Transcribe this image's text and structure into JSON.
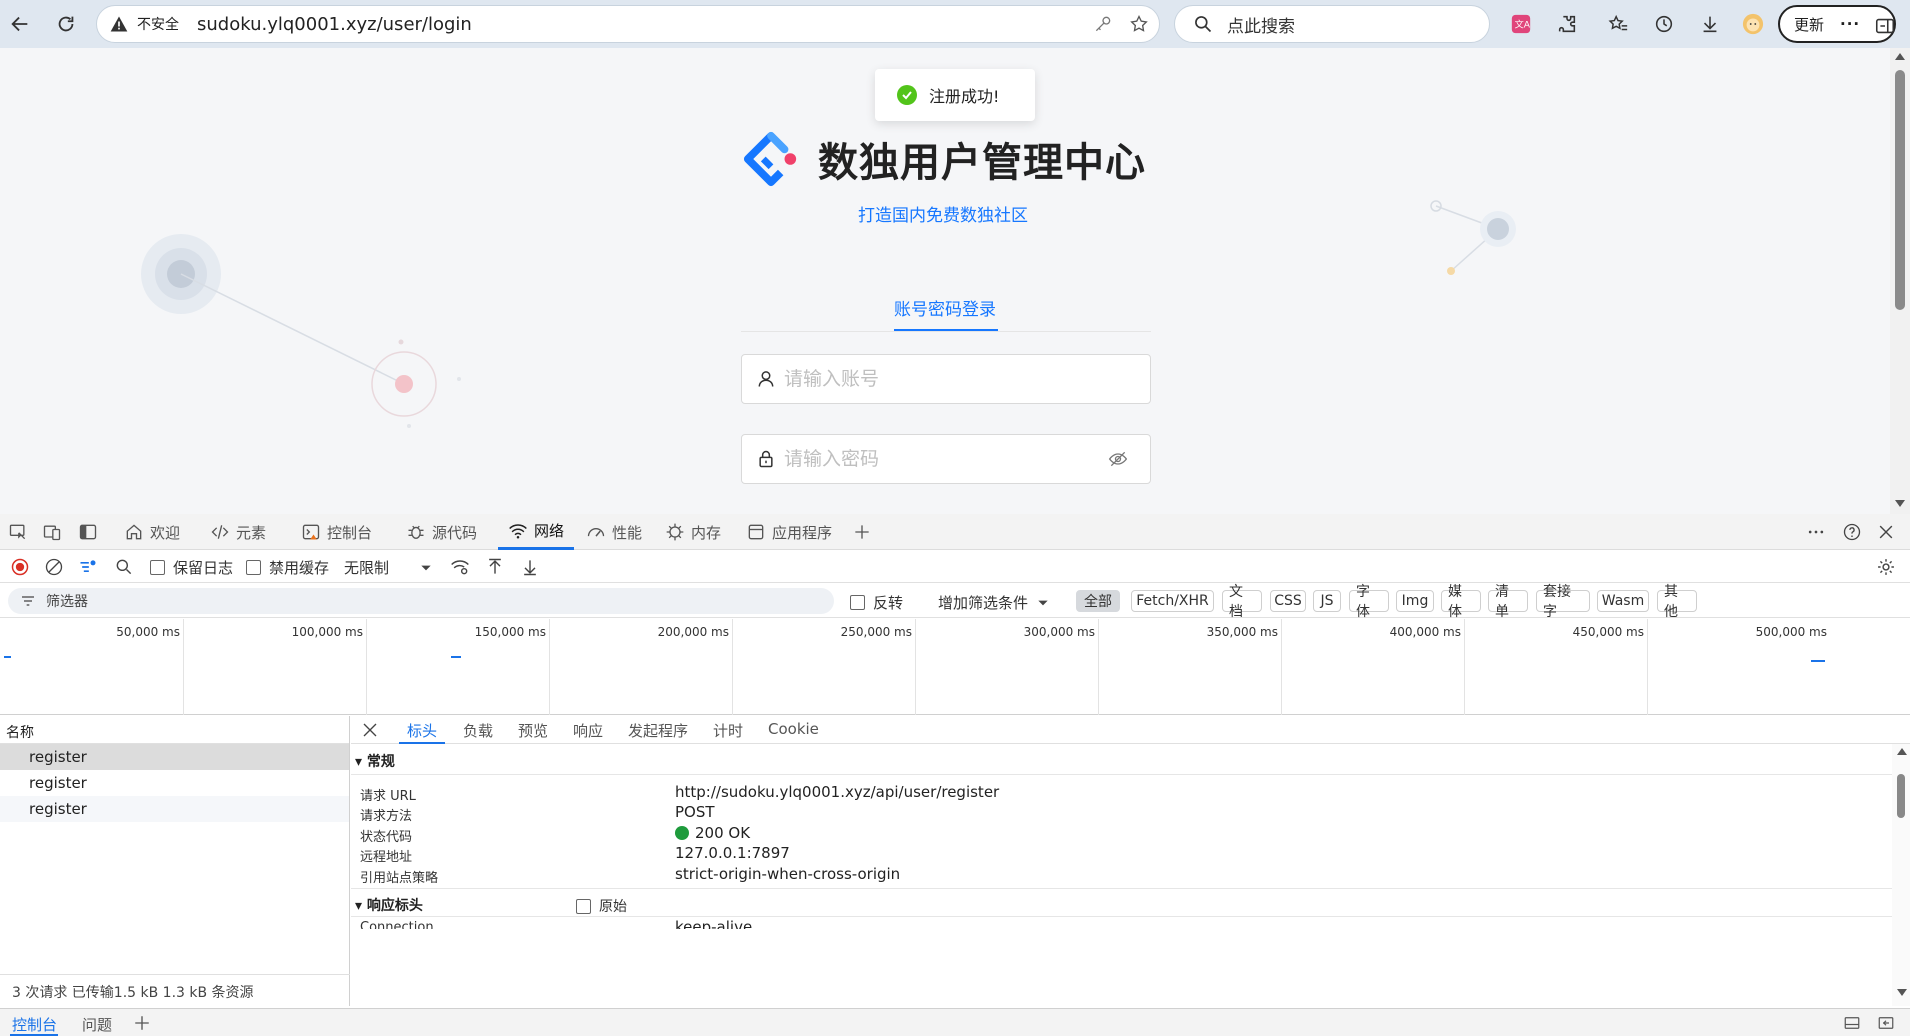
{
  "browser": {
    "insecure_label": "不安全",
    "url": "sudoku.ylq0001.xyz/user/login",
    "search_placeholder": "点此搜索",
    "update_label": "更新",
    "more_label": "···"
  },
  "page": {
    "toast": "注册成功!",
    "title": "数独用户管理中心",
    "tagline": "打造国内免费数独社区",
    "login_tab": "账号密码登录",
    "account_placeholder": "请输入账号",
    "password_placeholder": "请输入密码"
  },
  "devtools": {
    "tabs": [
      "欢迎",
      "元素",
      "控制台",
      "源代码",
      "网络",
      "性能",
      "内存",
      "应用程序"
    ],
    "active_tab": "网络",
    "toolbar": {
      "preserve_log": "保留日志",
      "disable_cache": "禁用缓存",
      "throttling": "无限制"
    },
    "filter": {
      "placeholder": "筛选器",
      "invert": "反转",
      "more_filters": "增加筛选条件",
      "types": [
        "全部",
        "Fetch/XHR",
        "文档",
        "CSS",
        "JS",
        "字体",
        "Img",
        "媒体",
        "清单",
        "套接字",
        "Wasm",
        "其他"
      ]
    },
    "timeline_ticks": [
      "50,000 ms",
      "100,000 ms",
      "150,000 ms",
      "200,000 ms",
      "250,000 ms",
      "300,000 ms",
      "350,000 ms",
      "400,000 ms",
      "450,000 ms",
      "500,000 ms"
    ],
    "request_list": {
      "header": "名称",
      "rows": [
        "register",
        "register",
        "register"
      ],
      "summary": "3 次请求   已传输1.5 kB   1.3 kB 条资源"
    },
    "detail": {
      "tabs": [
        "标头",
        "负载",
        "预览",
        "响应",
        "发起程序",
        "计时",
        "Cookie"
      ],
      "general_title": "常规",
      "general": [
        {
          "k": "请求 URL",
          "v": "http://sudoku.ylq0001.xyz/api/user/register"
        },
        {
          "k": "请求方法",
          "v": "POST"
        },
        {
          "k": "状态代码",
          "v": "200 OK"
        },
        {
          "k": "远程地址",
          "v": "127.0.0.1:7897"
        },
        {
          "k": "引用站点策略",
          "v": "strict-origin-when-cross-origin"
        }
      ],
      "response_headers_title": "响应标头",
      "raw_label": "原始",
      "partial_row_k": "Connection",
      "partial_row_v": "keep-alive"
    },
    "drawer": {
      "tabs": [
        "控制台",
        "问题"
      ]
    }
  }
}
